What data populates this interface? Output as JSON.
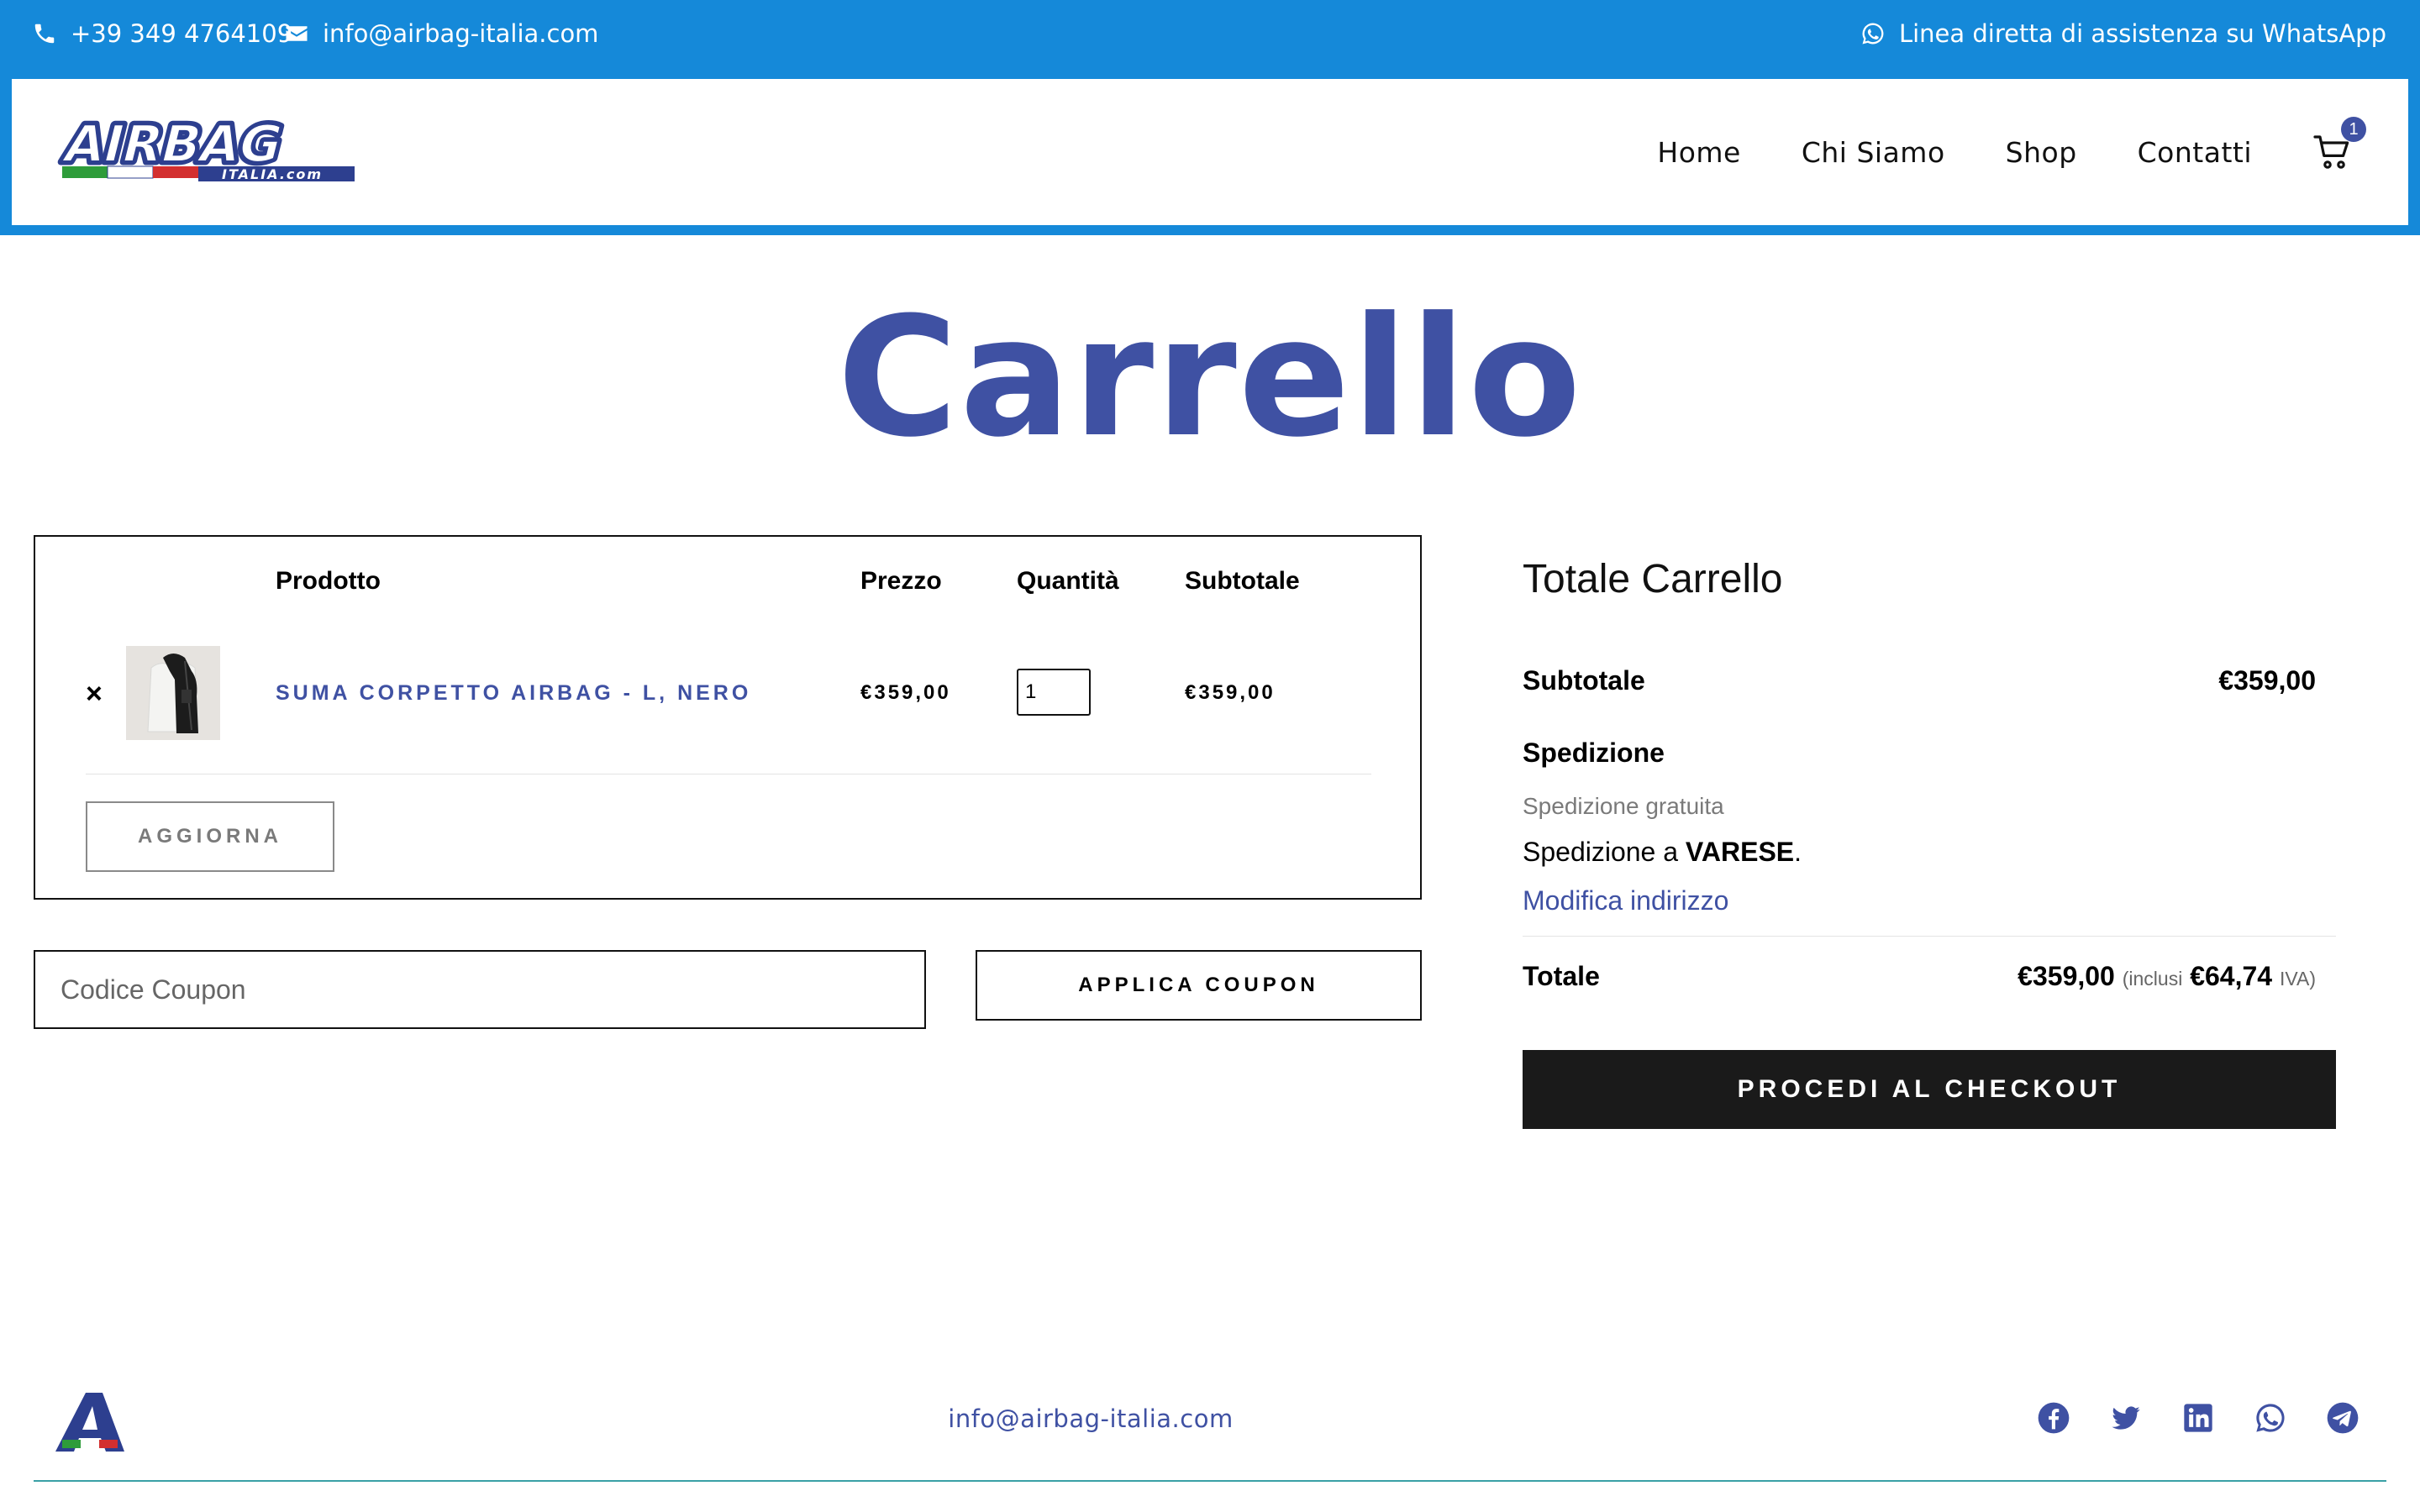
{
  "topbar": {
    "phone": "+39 349 4764109",
    "email": "info@airbag-italia.com",
    "whatsapp": "Linea diretta di assistenza su WhatsApp"
  },
  "header": {
    "logo_text": "AIRBAG",
    "logo_subtext": "ITALIA.com",
    "nav": [
      "Home",
      "Chi Siamo",
      "Shop",
      "Contatti"
    ],
    "cart_count": "1"
  },
  "page_title": "Carrello",
  "cart": {
    "columns": [
      "Prodotto",
      "Prezzo",
      "Quantità",
      "Subtotale"
    ],
    "items": [
      {
        "remove": "×",
        "name": "SUMA CORPETTO AIRBAG - L, NERO",
        "price": "€359,00",
        "quantity": "1",
        "subtotal": "€359,00"
      }
    ],
    "update_label": "AGGIORNA"
  },
  "coupon": {
    "placeholder": "Codice Coupon",
    "apply_label": "APPLICA COUPON"
  },
  "totals": {
    "title": "Totale Carrello",
    "subtotal_label": "Subtotale",
    "subtotal_value": "€359,00",
    "shipping_label": "Spedizione",
    "shipping_method": "Spedizione gratuita",
    "shipping_to_prefix": "Spedizione a ",
    "shipping_city": "VARESE",
    "shipping_to_suffix": ".",
    "change_address": "Modifica indirizzo",
    "total_label": "Totale",
    "total_value": "€359,00",
    "tax_prefix": "(inclusi",
    "tax_value": "€64,74",
    "tax_suffix": "IVA)",
    "checkout_label": "PROCEDI AL CHECKOUT"
  },
  "footer": {
    "email": "info@airbag-italia.com",
    "socials": [
      "facebook-icon",
      "twitter-icon",
      "linkedin-icon",
      "whatsapp-icon",
      "telegram-icon"
    ]
  },
  "colors": {
    "topbar_blue": "#1589d9",
    "brand_blue": "#3f51a3",
    "checkout_black": "#1a1a1a"
  }
}
